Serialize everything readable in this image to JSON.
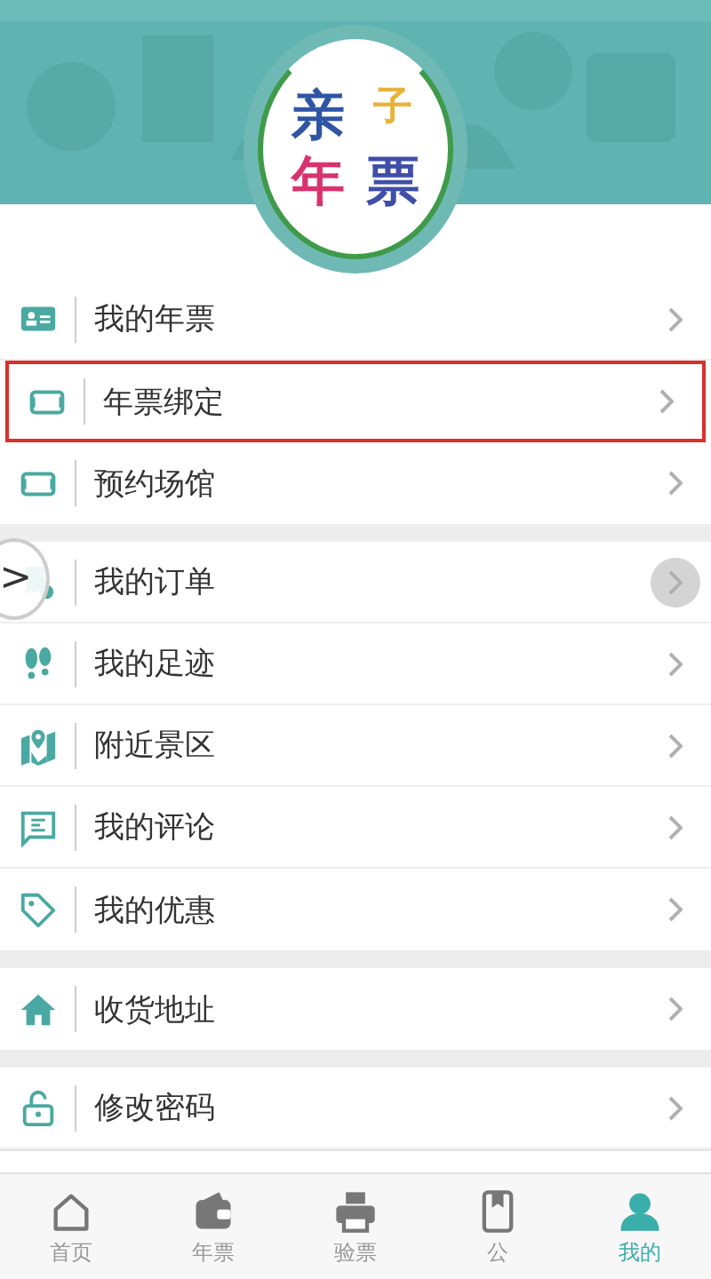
{
  "logo": {
    "chars": [
      {
        "text": "亲",
        "color": "#2f55a4"
      },
      {
        "text": "子",
        "color": "#e8b23a"
      },
      {
        "text": "年",
        "color": "#d8336e"
      },
      {
        "text": "票",
        "color": "#3f4fa8"
      }
    ]
  },
  "groups": [
    {
      "items": [
        {
          "label": "我的年票",
          "highlighted": false,
          "pressed": false
        },
        {
          "label": "年票绑定",
          "highlighted": true,
          "pressed": false
        },
        {
          "label": "预约场馆",
          "highlighted": false,
          "pressed": false
        }
      ]
    },
    {
      "items": [
        {
          "label": "我的订单",
          "highlighted": false,
          "pressed": true
        },
        {
          "label": "我的足迹",
          "highlighted": false,
          "pressed": false
        },
        {
          "label": "附近景区",
          "highlighted": false,
          "pressed": false
        },
        {
          "label": "我的评论",
          "highlighted": false,
          "pressed": false
        },
        {
          "label": "我的优惠",
          "highlighted": false,
          "pressed": false
        }
      ]
    },
    {
      "items": [
        {
          "label": "收货地址",
          "highlighted": false,
          "pressed": false
        }
      ]
    },
    {
      "items": [
        {
          "label": "修改密码",
          "highlighted": false,
          "pressed": false
        }
      ]
    }
  ],
  "side_handle": {
    "icon": ">"
  },
  "tab_bar": [
    {
      "label": "首页",
      "selected": false
    },
    {
      "label": "年票",
      "selected": false
    },
    {
      "label": "验票",
      "selected": false
    },
    {
      "label": "公",
      "selected": false
    },
    {
      "label": "我的",
      "selected": true
    }
  ]
}
